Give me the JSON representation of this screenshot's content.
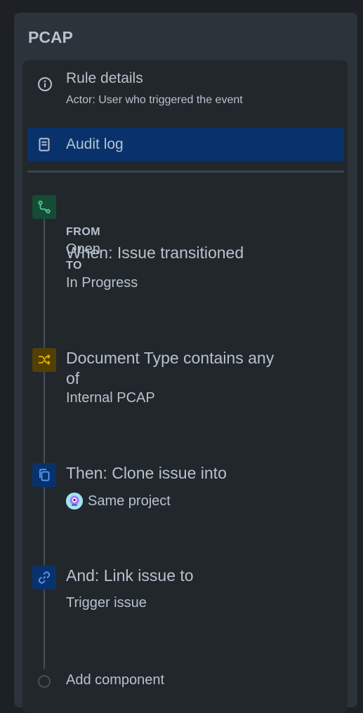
{
  "panel": {
    "title": "PCAP"
  },
  "rule_details": {
    "title": "Rule details",
    "subtitle": "Actor: User who triggered the event",
    "icon": "info-icon"
  },
  "audit_log": {
    "label": "Audit log",
    "icon": "document-icon",
    "selected": true
  },
  "steps": [
    {
      "title": "When: Issue transitioned",
      "icon": "transition-icon",
      "color": "#1f845a",
      "from_label": "FROM",
      "from_value": "Open",
      "to_label": "TO",
      "to_value": "In Progress"
    },
    {
      "title_line1": "Document Type contains any",
      "title_line2": "of",
      "icon": "shuffle-icon",
      "color": "#b38600",
      "value": "Internal PCAP"
    },
    {
      "title": "Then: Clone issue into",
      "icon": "copy-icon",
      "color": "#0c66e4",
      "value": "Same project",
      "value_icon": "project-avatar-icon"
    },
    {
      "title": "And: Link issue to",
      "icon": "link-icon",
      "color": "#0c66e4",
      "value": "Trigger issue"
    }
  ],
  "add_component": {
    "label": "Add component"
  },
  "colors": {
    "background": "#1d2125",
    "panel": "#2c333a",
    "inner": "#22272b",
    "selected": "#09326c",
    "text": "#b6c2cf"
  }
}
